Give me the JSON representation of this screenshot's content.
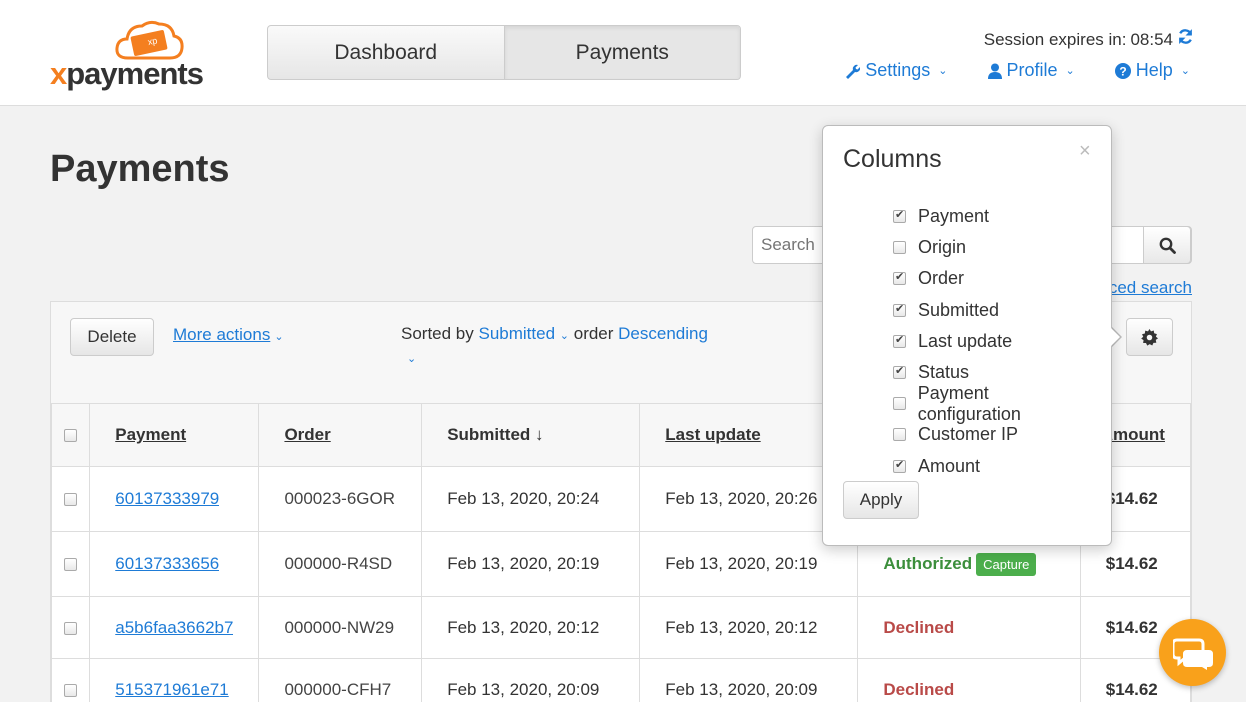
{
  "header": {
    "logo_text_x": "x",
    "logo_text_rest": "payments",
    "logo_badge": "xp",
    "tabs": [
      {
        "label": "Dashboard",
        "active": false
      },
      {
        "label": "Payments",
        "active": true
      }
    ],
    "session_label": "Session expires in:",
    "session_time": "08:54",
    "nav": [
      {
        "label": "Settings",
        "icon": "wrench-icon"
      },
      {
        "label": "Profile",
        "icon": "user-icon"
      },
      {
        "label": "Help",
        "icon": "question-icon"
      }
    ]
  },
  "page": {
    "title": "Payments",
    "search_placeholder": "Search",
    "advanced_search": "ced search"
  },
  "toolbar": {
    "delete_label": "Delete",
    "more_actions": "More actions",
    "sorted_by_label": "Sorted by",
    "sorted_by_value": "Submitted",
    "order_label": "order",
    "order_value": "Descending"
  },
  "table": {
    "headers": [
      "Payment",
      "Order",
      "Submitted ↓",
      "Last update",
      "Amount"
    ],
    "rows": [
      {
        "payment": "60137333979",
        "order": "000023-6GOR",
        "submitted": "Feb 13, 2020, 20:24",
        "last_update": "Feb 13, 2020, 20:26",
        "status": "",
        "capture": "",
        "amount": "$14.62"
      },
      {
        "payment": "60137333656",
        "order": "000000-R4SD",
        "submitted": "Feb 13, 2020, 20:19",
        "last_update": "Feb 13, 2020, 20:19",
        "status": "Authorized",
        "capture": "Capture",
        "amount": "$14.62"
      },
      {
        "payment": "a5b6faa3662b7",
        "order": "000000-NW29",
        "submitted": "Feb 13, 2020, 20:12",
        "last_update": "Feb 13, 2020, 20:12",
        "status": "Declined",
        "capture": "",
        "amount": "$14.62"
      },
      {
        "payment": "515371961e71",
        "order": "000000-CFH7",
        "submitted": "Feb 13, 2020, 20:09",
        "last_update": "Feb 13, 2020, 20:09",
        "status": "Declined",
        "capture": "",
        "amount": "$14.62"
      }
    ]
  },
  "popover": {
    "title": "Columns",
    "close": "×",
    "columns": [
      {
        "label": "Payment",
        "checked": true
      },
      {
        "label": "Origin",
        "checked": false
      },
      {
        "label": "Order",
        "checked": true
      },
      {
        "label": "Submitted",
        "checked": true
      },
      {
        "label": "Last update",
        "checked": true
      },
      {
        "label": "Status",
        "checked": true
      },
      {
        "label": "Payment configuration",
        "checked": false
      },
      {
        "label": "Customer IP",
        "checked": false
      },
      {
        "label": "Amount",
        "checked": true
      }
    ],
    "apply_label": "Apply"
  },
  "colors": {
    "link": "#1e7bd6",
    "brand_orange": "#f47f20",
    "authorized": "#3c8f3c",
    "declined": "#b94a48",
    "capture": "#4cae4c",
    "chat": "#f9a11b"
  }
}
